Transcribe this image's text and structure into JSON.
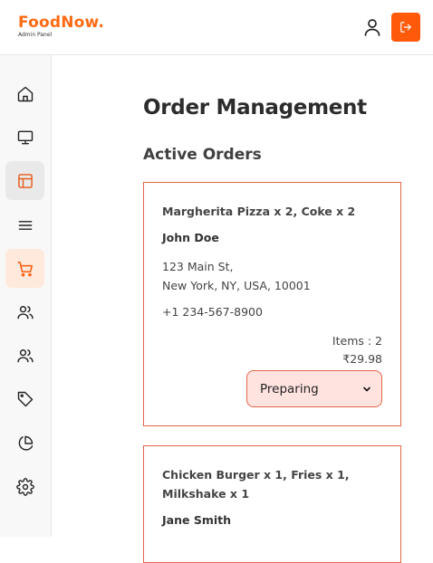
{
  "header": {
    "brand_name": "FoodNow.",
    "brand_subtitle": "Admin Panel",
    "user_icon": "user-icon",
    "logout_icon": "logout-icon",
    "accent_color": "#ff5a0a"
  },
  "sidebar": {
    "items": [
      {
        "icon": "home-icon",
        "state": "normal"
      },
      {
        "icon": "monitor-icon",
        "state": "normal"
      },
      {
        "icon": "layout-icon",
        "state": "selected"
      },
      {
        "icon": "menu-icon",
        "state": "normal"
      },
      {
        "icon": "cart-icon",
        "state": "active"
      },
      {
        "icon": "users-icon",
        "state": "normal"
      },
      {
        "icon": "users-icon",
        "state": "normal"
      },
      {
        "icon": "tag-icon",
        "state": "normal"
      },
      {
        "icon": "pie-chart-icon",
        "state": "normal"
      },
      {
        "icon": "gear-icon",
        "state": "normal"
      }
    ]
  },
  "main": {
    "title": "Order Management",
    "section_title": "Active Orders",
    "orders": [
      {
        "items": "Margherita Pizza x 2, Coke x 2",
        "customer": "John Doe",
        "address_line1": "123 Main St,",
        "address_line2": "New York, NY, USA, 10001",
        "phone": "+1 234-567-8900",
        "items_count": "Items : 2",
        "total": "₹29.98",
        "status": "Preparing"
      },
      {
        "items": "Chicken Burger x 1, Fries x 1, Milkshake x 1",
        "customer": "Jane Smith"
      }
    ]
  }
}
